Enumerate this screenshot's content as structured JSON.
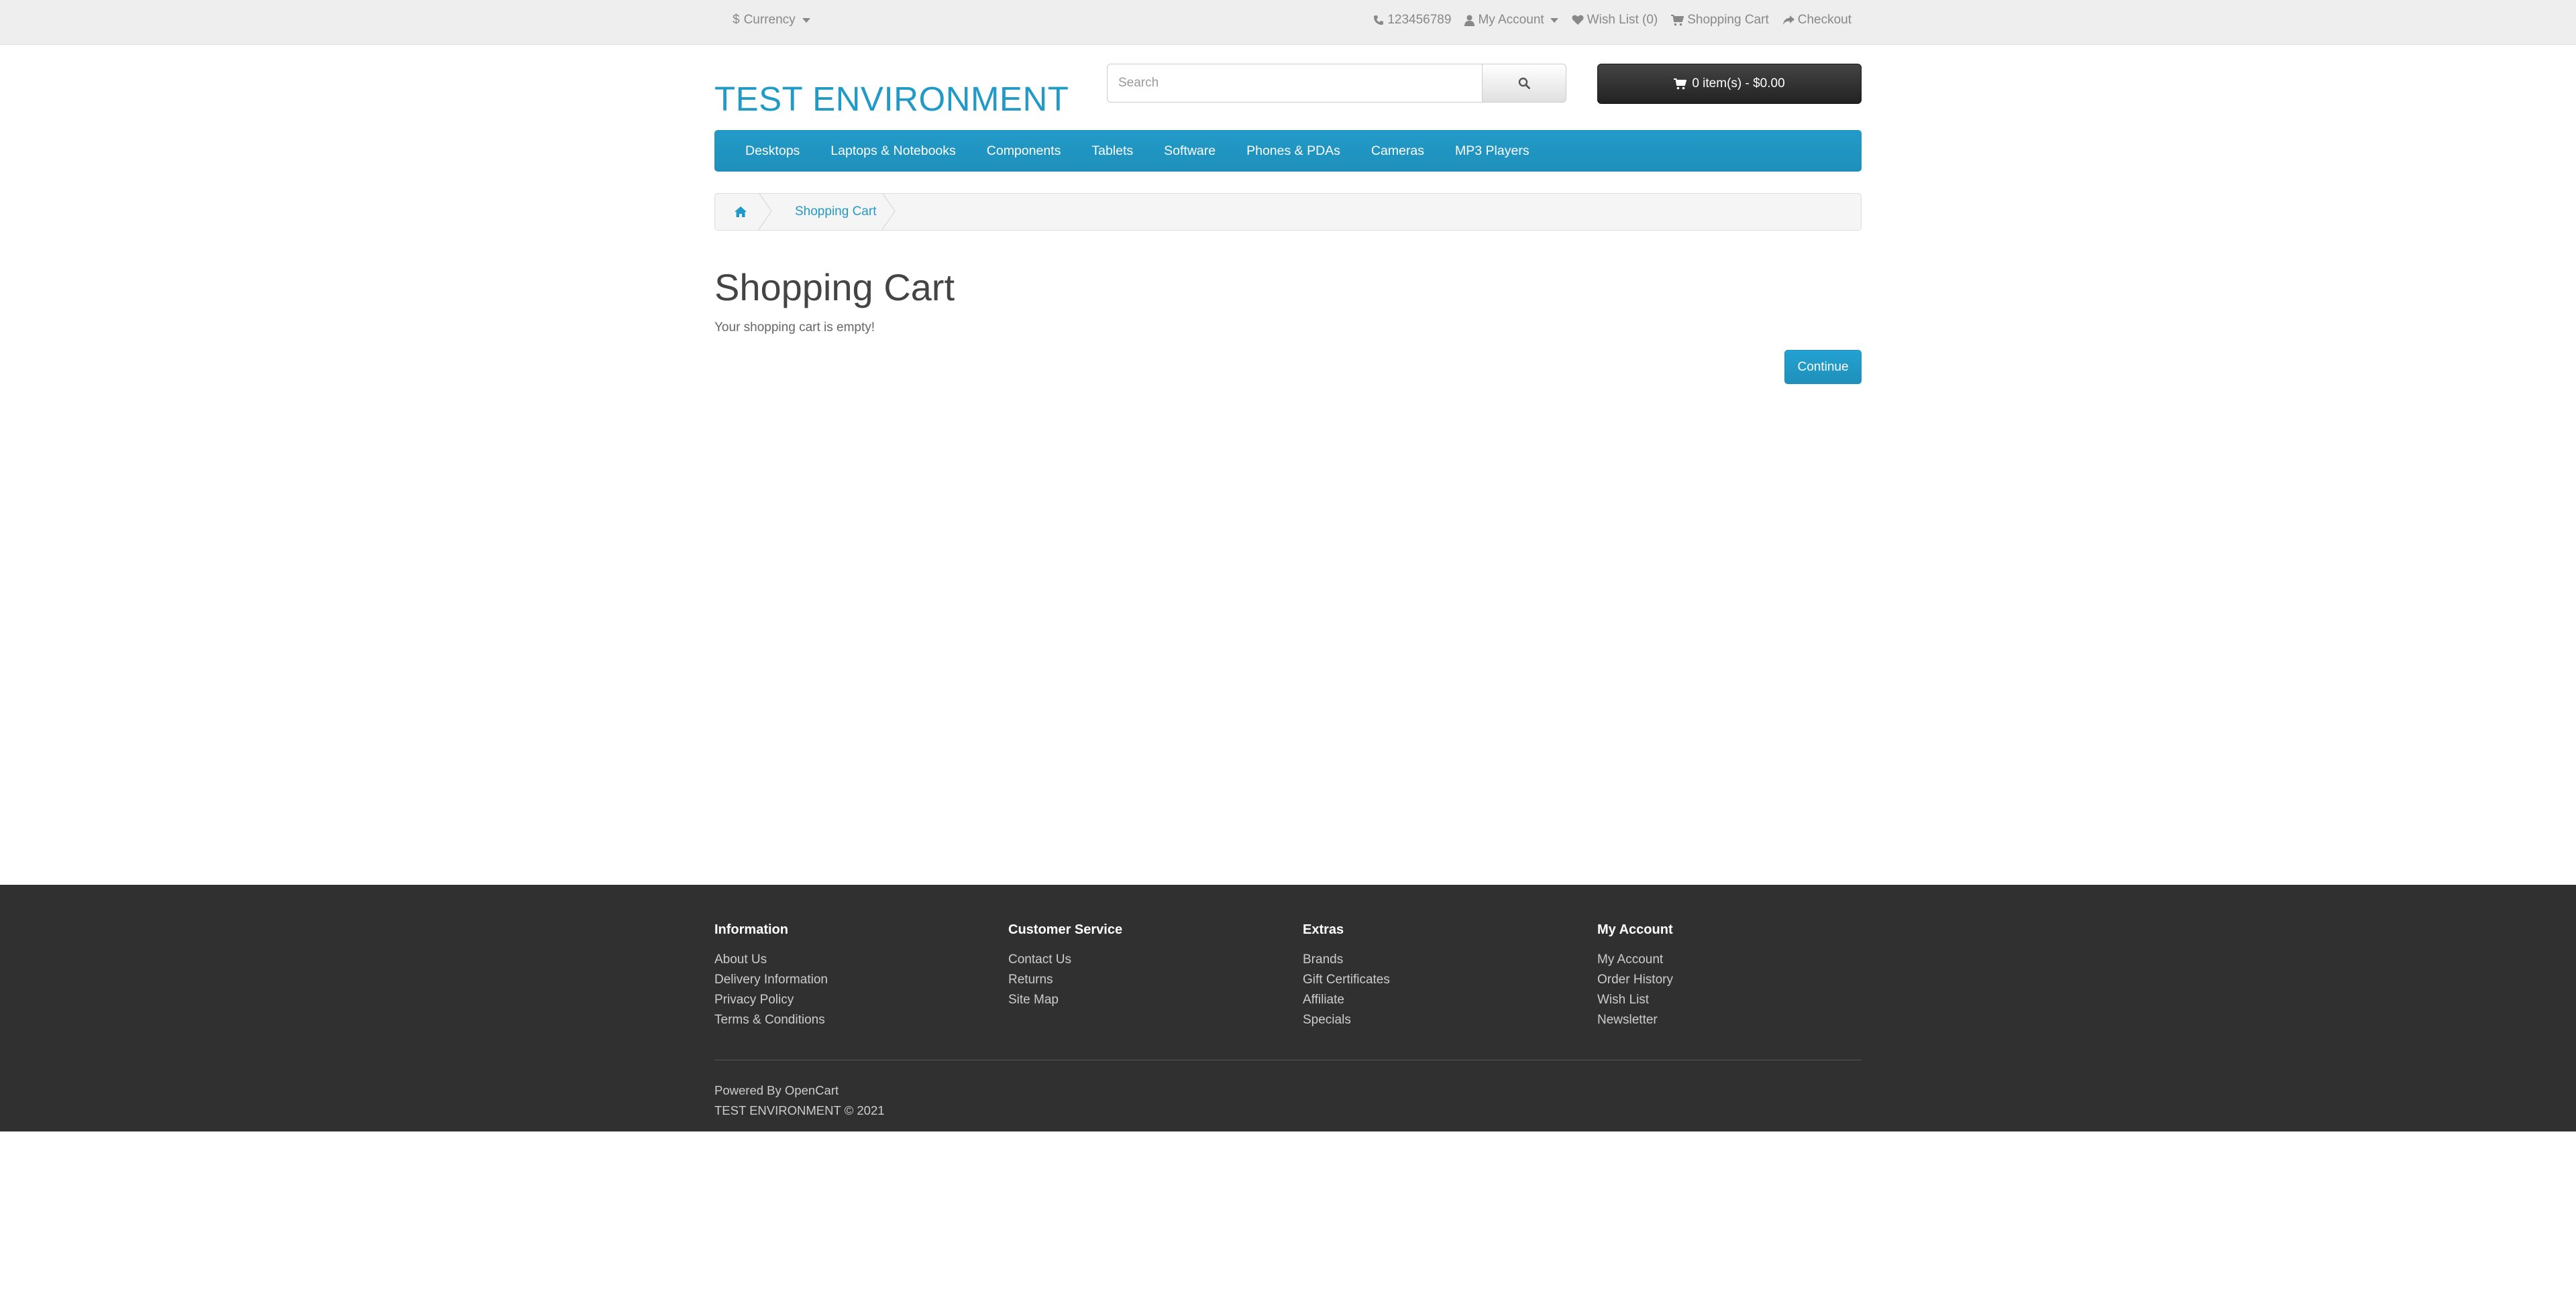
{
  "topbar": {
    "currency_symbol": "$",
    "currency_label": "Currency",
    "phone": "123456789",
    "my_account": "My Account",
    "wish_list": "Wish List (0)",
    "shopping_cart": "Shopping Cart",
    "checkout": "Checkout"
  },
  "header": {
    "logo": "TEST ENVIRONMENT",
    "search_placeholder": "Search",
    "cart_button": "0 item(s) - $0.00"
  },
  "menu": {
    "items": [
      "Desktops",
      "Laptops & Notebooks",
      "Components",
      "Tablets",
      "Software",
      "Phones & PDAs",
      "Cameras",
      "MP3 Players"
    ]
  },
  "breadcrumb": {
    "current": "Shopping Cart"
  },
  "content": {
    "title": "Shopping Cart",
    "message": "Your shopping cart is empty!",
    "continue_label": "Continue"
  },
  "footer": {
    "columns": [
      {
        "heading": "Information",
        "links": [
          "About Us",
          "Delivery Information",
          "Privacy Policy",
          "Terms & Conditions"
        ]
      },
      {
        "heading": "Customer Service",
        "links": [
          "Contact Us",
          "Returns",
          "Site Map"
        ]
      },
      {
        "heading": "Extras",
        "links": [
          "Brands",
          "Gift Certificates",
          "Affiliate",
          "Specials"
        ]
      },
      {
        "heading": "My Account",
        "links": [
          "My Account",
          "Order History",
          "Wish List",
          "Newsletter"
        ]
      }
    ],
    "powered_by": "Powered By",
    "powered_link": "OpenCart",
    "copyright": "TEST ENVIRONMENT © 2021"
  },
  "colors": {
    "accent": "#229ac8",
    "footer_bg": "#303030",
    "topbar_bg": "#eeeeee"
  }
}
